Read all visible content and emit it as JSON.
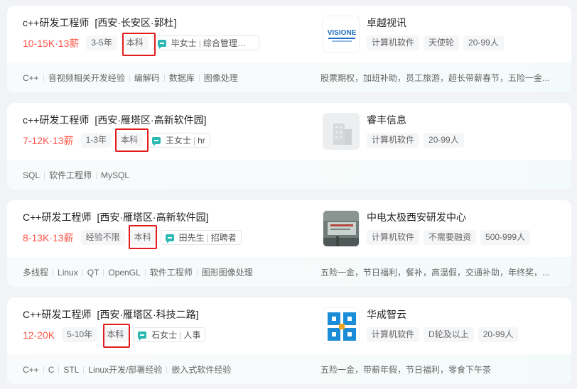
{
  "jobs": [
    {
      "title": "c++研发工程师",
      "location": "[西安·长安区·郭杜]",
      "salary": "10-15K·13薪",
      "experience": "3-5年",
      "education": "本科",
      "recruiter_name": "毕女士",
      "recruiter_role": "综合管理部 ...",
      "skills": [
        "C++",
        "音视频相关开发经验",
        "编解码",
        "数据库",
        "图像处理"
      ],
      "company_name": "卓越视讯",
      "company_tags": [
        "计算机软件",
        "天使轮",
        "20-99人"
      ],
      "welfare": "股票期权，加班补助，员工旅游，超长带薪春节，五险一金..."
    },
    {
      "title": "c++研发工程师",
      "location": "[西安·雁塔区·高新软件园]",
      "salary": "7-12K·13薪",
      "experience": "1-3年",
      "education": "本科",
      "recruiter_name": "王女士",
      "recruiter_role": "hr",
      "skills": [
        "SQL",
        "软件工程师",
        "MySQL"
      ],
      "company_name": "睿丰信息",
      "company_tags": [
        "计算机软件",
        "20-99人"
      ],
      "welfare": ""
    },
    {
      "title": "C++研发工程师",
      "location": "[西安·雁塔区·高新软件园]",
      "salary": "8-13K·13薪",
      "experience": "经验不限",
      "education": "本科",
      "recruiter_name": "田先生",
      "recruiter_role": "招聘者",
      "skills": [
        "多线程",
        "Linux",
        "QT",
        "OpenGL",
        "软件工程师",
        "图形图像处理"
      ],
      "company_name": "中电太极西安研发中心",
      "company_tags": [
        "计算机软件",
        "不需要融资",
        "500-999人"
      ],
      "welfare": "五险一金，节日福利，餐补，高温假，交通补助，年终奖，..."
    },
    {
      "title": "C++研发工程师",
      "location": "[西安·雁塔区·科技二路]",
      "salary": "12-20K",
      "experience": "5-10年",
      "education": "本科",
      "recruiter_name": "石女士",
      "recruiter_role": "人事",
      "skills": [
        "C++",
        "C",
        "STL",
        "Linux开发/部署经验",
        "嵌入式软件经验"
      ],
      "company_name": "华成智云",
      "company_tags": [
        "计算机软件",
        "D轮及以上",
        "20-99人"
      ],
      "welfare": "五险一金，带薪年假，节日福利，零食下午茶"
    }
  ],
  "logos": [
    {
      "icon": "visione-logo",
      "text": "VISIONE"
    },
    {
      "icon": "building-placeholder-logo"
    },
    {
      "icon": "office-photo-logo"
    },
    {
      "icon": "huacheng-logo"
    }
  ],
  "colors": {
    "salary": "#fe574a",
    "highlight_box": "#e21c1c",
    "chat_icon": "#2bb8b3"
  }
}
